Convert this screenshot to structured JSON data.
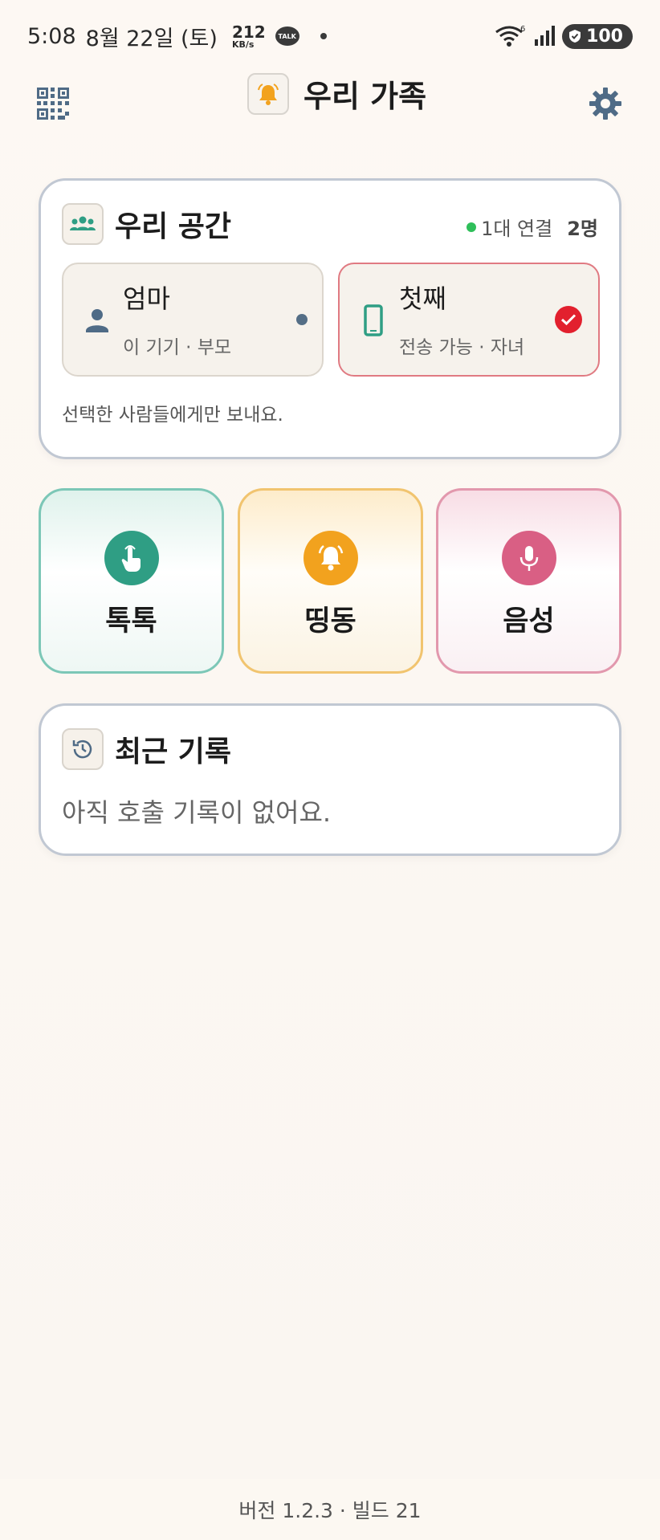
{
  "status_bar": {
    "time": "5:08",
    "date": "8월 22일 (토)",
    "net_speed": "212",
    "net_unit": "KB/s",
    "talk_badge": "TALK",
    "wifi_badge": "6",
    "battery": "100"
  },
  "header": {
    "title": "우리 가족",
    "icons": {
      "qr": "qr-code-icon",
      "bell": "bell-icon",
      "settings": "gear-icon"
    }
  },
  "space": {
    "title": "우리 공간",
    "connected": "1대 연결",
    "count": "2명",
    "members": [
      {
        "name": "엄마",
        "sub": "이 기기 · 부모",
        "icon": "person-icon",
        "selected": false
      },
      {
        "name": "첫째",
        "sub": "전송 가능 · 자녀",
        "icon": "phone-icon",
        "selected": true
      }
    ],
    "hint": "선택한 사람들에게만 보내요."
  },
  "actions": [
    {
      "label": "톡톡",
      "icon": "tap-hand-icon",
      "color": "#2f9e84"
    },
    {
      "label": "띵동",
      "icon": "ringing-bell-icon",
      "color": "#f2a21e"
    },
    {
      "label": "음성",
      "icon": "microphone-icon",
      "color": "#d95f84"
    }
  ],
  "recent": {
    "title": "최근 기록",
    "empty": "아직 호출 기록이 없어요."
  },
  "footer": {
    "version": "버전 1.2.3 · 빌드 21"
  },
  "colors": {
    "accent_green": "#2f9e84",
    "accent_orange": "#f2a21e",
    "accent_pink": "#d95f84",
    "selected_red": "#e2202e",
    "online_green": "#2fbf5a"
  }
}
